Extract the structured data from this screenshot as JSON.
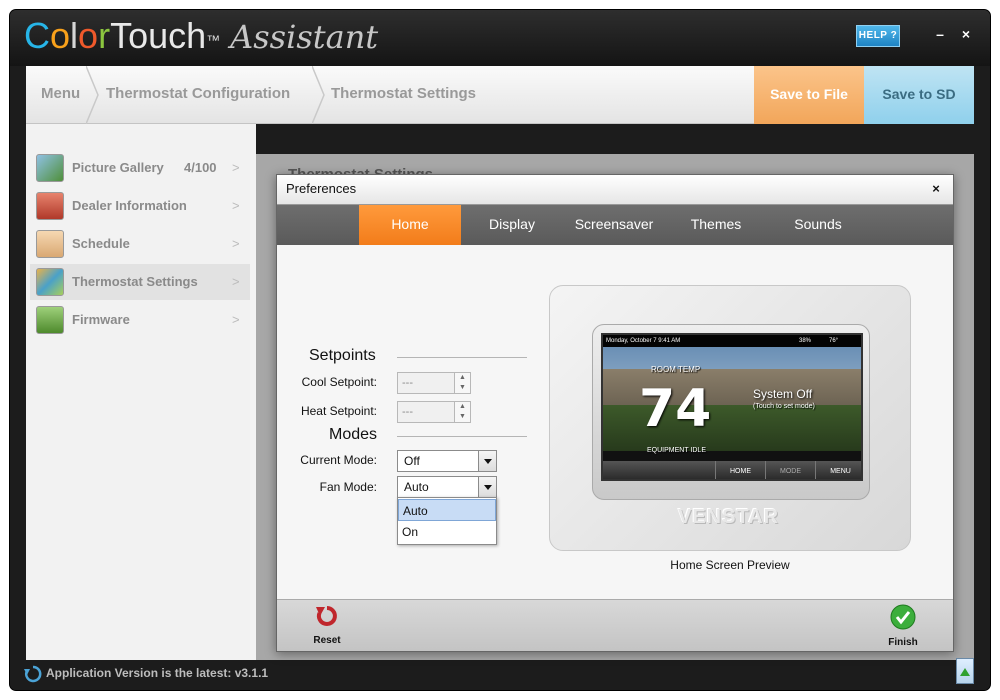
{
  "app": {
    "logo": {
      "brand_letters": [
        "C",
        "o",
        "l",
        "o",
        "r"
      ],
      "brand_rest": "Touch",
      "trademark": "™",
      "subtitle": "Assistant"
    },
    "help_label": "HELP ?",
    "window_buttons": {
      "minimize": "–",
      "close": "×"
    }
  },
  "breadcrumb": {
    "items": [
      "Menu",
      "Thermostat Configuration",
      "Thermostat Settings"
    ],
    "save_to_file": "Save to File",
    "save_to_sd": "Save to SD"
  },
  "sidebar": {
    "items": [
      {
        "label": "Picture Gallery",
        "count": "4/100",
        "chevron": ">",
        "icon": "picture-gallery-icon"
      },
      {
        "label": "Dealer Information",
        "chevron": ">",
        "icon": "dealer-information-icon"
      },
      {
        "label": "Schedule",
        "chevron": ">",
        "icon": "schedule-icon"
      },
      {
        "label": "Thermostat Settings",
        "chevron": ">",
        "icon": "thermostat-settings-icon"
      },
      {
        "label": "Firmware",
        "chevron": ">",
        "icon": "firmware-icon"
      }
    ],
    "active_index": 3
  },
  "content": {
    "title": "Thermostat Settings"
  },
  "footer": {
    "version_text": "Application Version is the latest: v3.1.1"
  },
  "dialog": {
    "title": "Preferences",
    "close": "×",
    "tabs": [
      "Home",
      "Display",
      "Screensaver",
      "Themes",
      "Sounds"
    ],
    "active_tab": "Home",
    "setpoints": {
      "heading": "Setpoints",
      "cool_label": "Cool Setpoint:",
      "cool_value": "---",
      "heat_label": "Heat Setpoint:",
      "heat_value": "---"
    },
    "modes": {
      "heading": "Modes",
      "current_label": "Current Mode:",
      "current_value": "Off",
      "fan_label": "Fan Mode:",
      "fan_value": "Auto",
      "fan_options": [
        "Auto",
        "On"
      ]
    },
    "preview": {
      "caption": "Home Screen Preview",
      "topbar": "Monday, October 7 9:41 AM",
      "humidity": "38%",
      "outdoor": "76°",
      "room_temp_label": "ROOM TEMP",
      "room_temp": "74",
      "system_status": "System Off",
      "touch_hint": "(Touch to set mode)",
      "equipment": "EQUIPMENT IDLE",
      "buttons": [
        "HOME",
        "MODE",
        "MENU"
      ],
      "brand": "VENSTAR"
    },
    "footer": {
      "reset": "Reset",
      "finish": "Finish"
    }
  },
  "colors": {
    "accent_orange": "#f27c1a",
    "save_sd_blue": "#8fd0ec",
    "help_blue": "#1e83c4",
    "finish_green": "#3cae3c",
    "reset_red": "#c0262c"
  }
}
